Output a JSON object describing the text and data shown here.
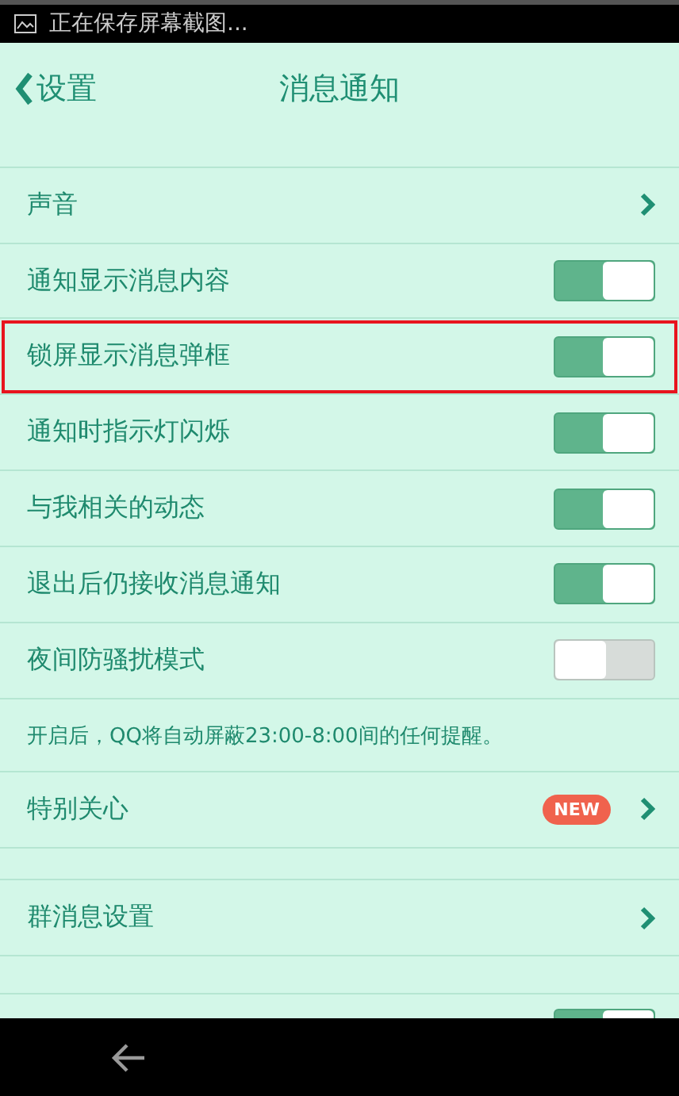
{
  "status_bar": {
    "text": "正在保存屏幕截图..."
  },
  "header": {
    "back_label": "设置",
    "title": "消息通知"
  },
  "items": [
    {
      "kind": "link",
      "label": "声音"
    },
    {
      "kind": "toggle",
      "label": "通知显示消息内容",
      "on": true,
      "highlighted": false
    },
    {
      "kind": "toggle",
      "label": "锁屏显示消息弹框",
      "on": true,
      "highlighted": true
    },
    {
      "kind": "toggle",
      "label": "通知时指示灯闪烁",
      "on": true,
      "highlighted": false
    },
    {
      "kind": "toggle",
      "label": "与我相关的动态",
      "on": true,
      "highlighted": false
    },
    {
      "kind": "toggle",
      "label": "退出后仍接收消息通知",
      "on": true,
      "highlighted": false
    },
    {
      "kind": "toggle",
      "label": "夜间防骚扰模式",
      "on": false,
      "highlighted": false
    },
    {
      "kind": "note",
      "text": "开启后，QQ将自动屏蔽23:00-8:00间的任何提醒。"
    },
    {
      "kind": "link",
      "label": "特别关心",
      "badge": "NEW"
    },
    {
      "kind": "gap"
    },
    {
      "kind": "link",
      "label": "群消息设置"
    },
    {
      "kind": "gap"
    },
    {
      "kind": "edge",
      "on": true
    }
  ]
}
